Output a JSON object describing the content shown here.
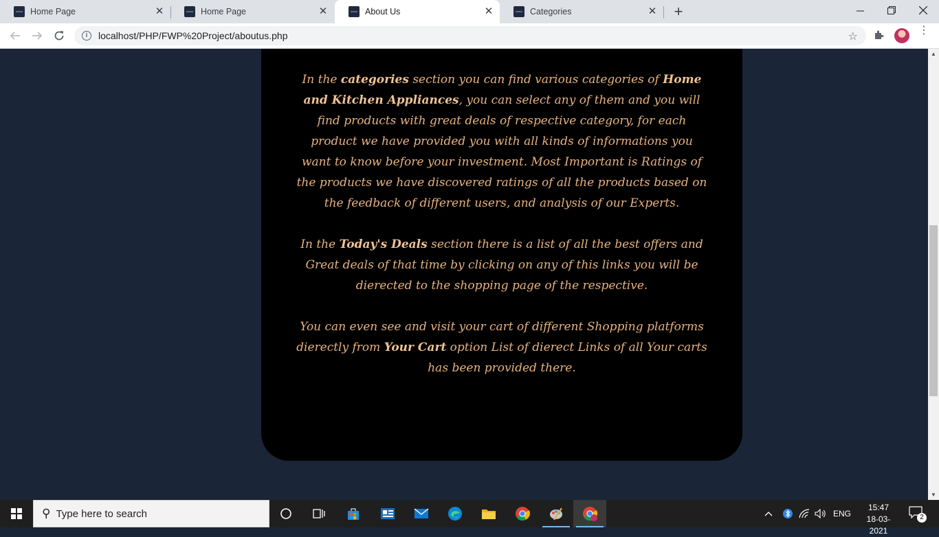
{
  "browser": {
    "tabs": [
      {
        "title": "Home Page",
        "active": false
      },
      {
        "title": "Home Page",
        "active": false
      },
      {
        "title": "About Us",
        "active": true
      },
      {
        "title": "Categories",
        "active": false
      }
    ],
    "url": "localhost/PHP/FWP%20Project/aboutus.php"
  },
  "page": {
    "paragraphs": [
      {
        "parts": [
          {
            "text": "In the ",
            "bold": false
          },
          {
            "text": "categories",
            "bold": true
          },
          {
            "text": " section you can find various categories of ",
            "bold": false
          },
          {
            "text": "Home and Kitchen Appliances",
            "bold": true
          },
          {
            "text": ", you can select any of them and you will find products with great deals of respective category, for each product we have provided you with all kinds of informations you want to know before your investment. Most Important is Ratings of the products we have discovered ratings of all the products based on the feedback of different users, and analysis of our Experts.",
            "bold": false
          }
        ]
      },
      {
        "parts": [
          {
            "text": "In the ",
            "bold": false
          },
          {
            "text": "Today's Deals",
            "bold": true
          },
          {
            "text": " section there is a list of all the best offers and Great deals of that time by clicking on any of this links you will be dierected to the shopping page of the respective.",
            "bold": false
          }
        ]
      },
      {
        "parts": [
          {
            "text": "You can even see and visit your cart of different Shopping platforms dierectly from ",
            "bold": false
          },
          {
            "text": "Your Cart",
            "bold": true
          },
          {
            "text": " option List of dierect Links of all Your carts has been provided there.",
            "bold": false
          }
        ]
      }
    ],
    "colors": {
      "background": "#1b2538",
      "card": "#000000",
      "text": "#e6b281"
    }
  },
  "taskbar": {
    "search_placeholder": "Type here to search",
    "language": "ENG",
    "time": "15:47",
    "date": "18-03-2021",
    "notification_count": "2"
  }
}
